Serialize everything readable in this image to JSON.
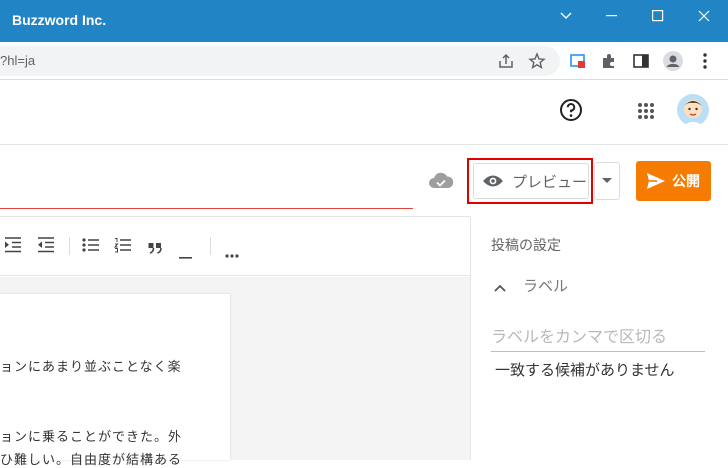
{
  "window": {
    "title": "Buzzword Inc."
  },
  "address_bar": {
    "url_fragment": "?hl=ja"
  },
  "editor": {
    "preview_label": "プレビュー",
    "publish_label": "公開",
    "body_lines": [
      "ョンにあまり並ぶことなく楽",
      "ョンに乗ることができた。外",
      "ひ難しい。自由度が結構ある"
    ]
  },
  "sidebar": {
    "heading": "投稿の設定",
    "labels_section": "ラベル",
    "labels_placeholder": "ラベルをカンマで区切る",
    "no_match_text": "一致する候補がありません"
  },
  "colors": {
    "titlebar": "#2185c5",
    "publish": "#f57c00",
    "preview_highlight": "#e00000",
    "title_underline": "#e0443a"
  }
}
